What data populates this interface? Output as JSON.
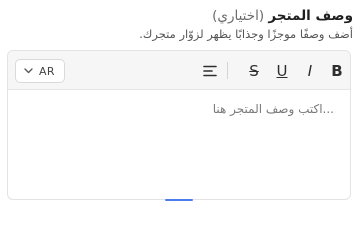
{
  "field": {
    "label": "وصف المتجر",
    "optional": "(اختياري)",
    "help": "أضف وصفًا موجزًا وجذابًا يظهر لزوّار متجرك."
  },
  "toolbar": {
    "language": {
      "selected": "AR",
      "icon": "chevron-down-icon"
    },
    "buttons": [
      {
        "name": "bold",
        "glyph": "B"
      },
      {
        "name": "italic",
        "glyph": "I"
      },
      {
        "name": "underline",
        "glyph": "U"
      },
      {
        "name": "strikethrough",
        "glyph": "S"
      },
      {
        "name": "align",
        "icon": "align-left-icon"
      }
    ]
  },
  "editor": {
    "placeholder": "...اكتب وصف المتجر هنا"
  },
  "colors": {
    "accent": "#4a7cf0",
    "toolbar_bg": "#f6f6f6",
    "border": "#e3e3e3"
  }
}
